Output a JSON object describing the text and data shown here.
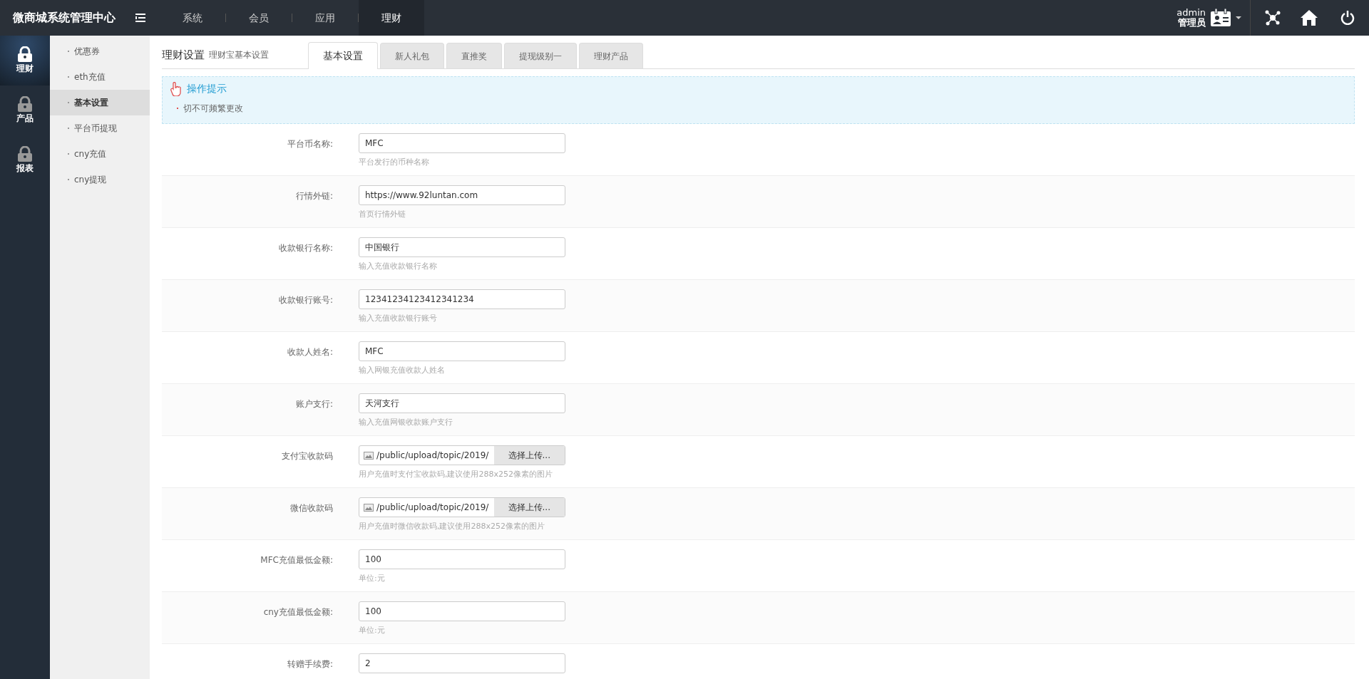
{
  "app_title": "微商城系统管理中心",
  "top_nav": [
    {
      "label": "系统",
      "selected": false
    },
    {
      "label": "会员",
      "selected": false
    },
    {
      "label": "应用",
      "selected": false
    },
    {
      "label": "理财",
      "selected": true
    }
  ],
  "user": {
    "name": "admin",
    "role": "管理员"
  },
  "rail": [
    {
      "label": "理财",
      "selected": true
    },
    {
      "label": "产品",
      "selected": false
    },
    {
      "label": "报表",
      "selected": false
    }
  ],
  "submenu": [
    {
      "label": "优惠券",
      "selected": false
    },
    {
      "label": "eth充值",
      "selected": false
    },
    {
      "label": "基本设置",
      "selected": true
    },
    {
      "label": "平台币提现",
      "selected": false
    },
    {
      "label": "cny充值",
      "selected": false
    },
    {
      "label": "cny提现",
      "selected": false
    }
  ],
  "page_title": "理财设置",
  "page_subtitle": "理财宝基本设置",
  "tabs": [
    {
      "label": "基本设置",
      "selected": true
    },
    {
      "label": "新人礼包",
      "selected": false
    },
    {
      "label": "直推奖",
      "selected": false
    },
    {
      "label": "提现级别一",
      "selected": false
    },
    {
      "label": "理财产品",
      "selected": false
    }
  ],
  "tip": {
    "title": "操作提示",
    "items": [
      "切不可频繁更改"
    ]
  },
  "form": [
    {
      "kind": "text",
      "label": "平台币名称:",
      "value": "MFC",
      "hint": "平台发行的币种名称"
    },
    {
      "kind": "text",
      "label": "行情外链:",
      "value": "https://www.92luntan.com",
      "hint": "首页行情外链"
    },
    {
      "kind": "text",
      "label": "收款银行名称:",
      "value": "中国银行",
      "hint": "输入充值收款银行名称"
    },
    {
      "kind": "text",
      "label": "收款银行账号:",
      "value": "12341234123412341234",
      "hint": "输入充值收款银行账号"
    },
    {
      "kind": "text",
      "label": "收款人姓名:",
      "value": "MFC",
      "hint": "输入网银充值收款人姓名"
    },
    {
      "kind": "text",
      "label": "账户支行:",
      "value": "天河支行",
      "hint": "输入充值网银收款账户支行"
    },
    {
      "kind": "file",
      "label": "支付宝收款码",
      "value": "/public/upload/topic/2019/",
      "button": "选择上传...",
      "hint": "用户充值时支付宝收款码,建议使用288x252像素的图片"
    },
    {
      "kind": "file",
      "label": "微信收款码",
      "value": "/public/upload/topic/2019/",
      "button": "选择上传...",
      "hint": "用户充值时微信收款码,建议使用288x252像素的图片"
    },
    {
      "kind": "text",
      "label": "MFC充值最低金额:",
      "value": "100",
      "hint": "单位:元"
    },
    {
      "kind": "text",
      "label": "cny充值最低金额:",
      "value": "100",
      "hint": "单位:元"
    },
    {
      "kind": "text",
      "label": "转赠手续费:",
      "value": "2"
    }
  ]
}
